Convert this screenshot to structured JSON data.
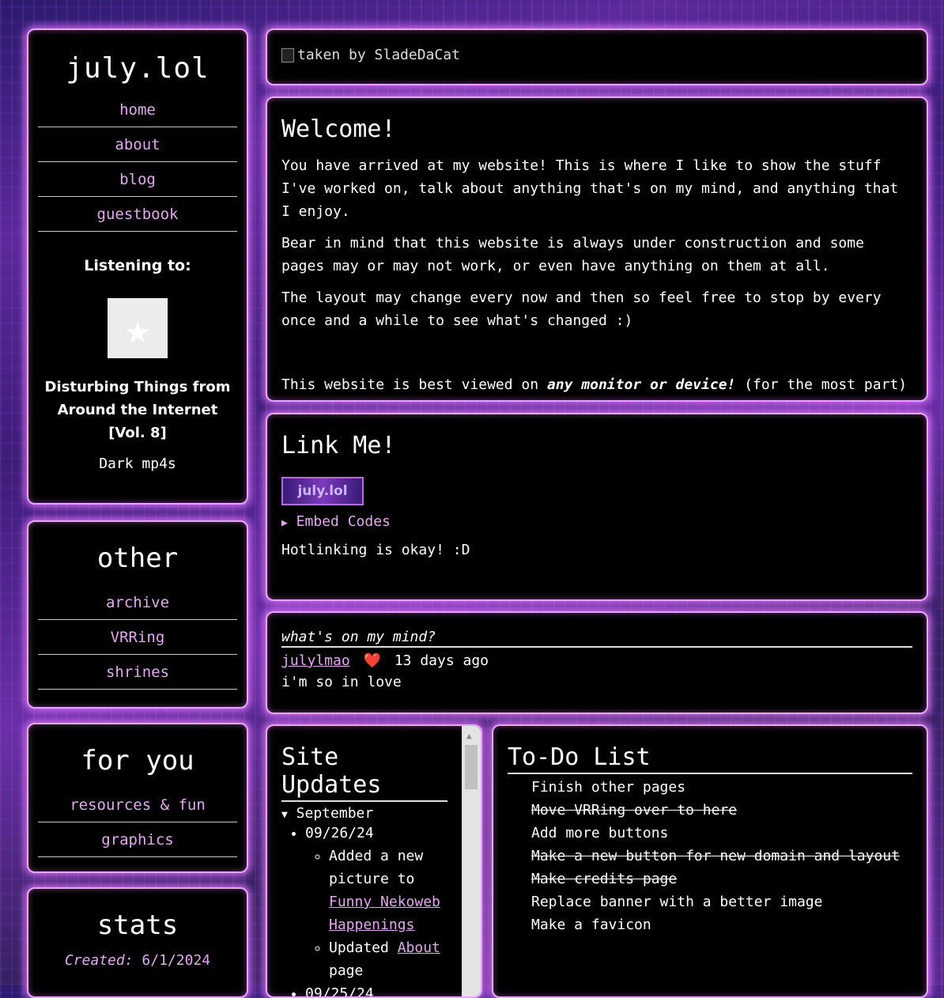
{
  "sidebar": {
    "title": "july.lol",
    "nav": [
      "home",
      "about",
      "blog",
      "guestbook"
    ],
    "listening_heading": "Listening to:",
    "album_icon": "star-icon",
    "song_title": "Disturbing Things from Around the Internet [Vol. 8]",
    "artist": "Dark mp4s"
  },
  "other": {
    "heading": "other",
    "links": [
      "archive",
      "VRRing",
      "shrines"
    ]
  },
  "for_you": {
    "heading": "for you",
    "links": [
      "resources & fun",
      "graphics"
    ]
  },
  "stats": {
    "heading": "stats",
    "created_label": "Created:",
    "created_value": "6/1/2024"
  },
  "banner": {
    "alt_text": "taken by SladeDaCat"
  },
  "welcome": {
    "heading": "Welcome!",
    "p1": "You have arrived at my website! This is where I like to show the stuff I've worked on, talk about anything that's on my mind, and anything that I enjoy.",
    "p2": "Bear in mind that this website is always under construction and some pages may or may not work, or even have anything on them at all.",
    "p3": "The layout may change every now and then so feel free to stop by every once and a while to see what's changed :)",
    "p4_before": "This website is best viewed on ",
    "p4_emph": "any monitor or device!",
    "p4_after": " (for the most part)"
  },
  "link_me": {
    "heading": "Link Me!",
    "button_text": "july.lol",
    "embed_label": "Embed Codes",
    "hotlink_text": "Hotlinking is okay! :D"
  },
  "mind": {
    "heading": "what's on my mind?",
    "user": "julylmao",
    "heart": "❤️",
    "time": "13 days ago",
    "message": "i'm so in love"
  },
  "site_updates": {
    "heading": "Site Updates",
    "month": "September",
    "entries": [
      {
        "date": "09/26/24"
      },
      {
        "date": "09/25/24"
      }
    ],
    "item1_before": "Added a new picture to ",
    "item1_link": "Funny Nekoweb Happenings",
    "item2_before": "Updated ",
    "item2_link": "About",
    "item2_after": " page"
  },
  "todo": {
    "heading": "To-Do List",
    "items": [
      {
        "text": "Finish other pages",
        "done": false
      },
      {
        "text": "Move VRRing over to here",
        "done": true
      },
      {
        "text": "Add more buttons",
        "done": false
      },
      {
        "text": "Make a new button for new domain and layout",
        "done": true
      },
      {
        "text": "Make credits page",
        "done": true
      },
      {
        "text": "Replace banner with a better image",
        "done": false
      },
      {
        "text": "Make a favicon",
        "done": false
      }
    ]
  }
}
